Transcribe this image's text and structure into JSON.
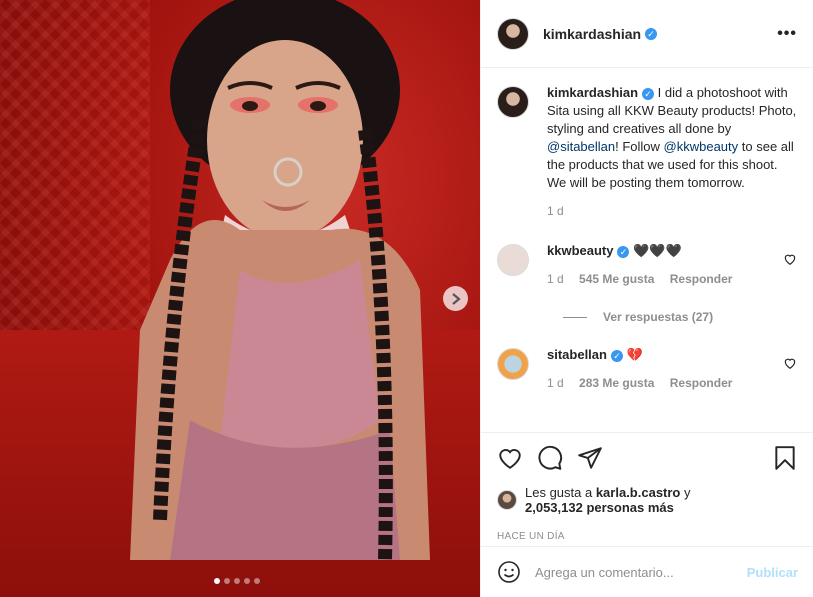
{
  "post": {
    "author": "kimkardashian",
    "more_icon": "more-horizontal-icon",
    "caption_text_1": "I did a photoshoot with Sita using all KKW Beauty products! Photo, styling and creatives all done by ",
    "caption_mention_1": "@sitabellan",
    "caption_text_2": "! Follow ",
    "caption_mention_2": "@kkwbeauty",
    "caption_text_3": " to see all the products that we used for this shoot. We will be posting them tomorrow.",
    "caption_time": "1 d",
    "carousel_total": 5,
    "carousel_active": 1
  },
  "comments": [
    {
      "user": "kkwbeauty",
      "text": "🖤🖤🖤",
      "time": "1 d",
      "likes": "545 Me gusta",
      "reply": "Responder",
      "view_replies": "Ver respuestas (27)"
    },
    {
      "user": "sitabellan",
      "text": "💔",
      "time": "1 d",
      "likes": "283 Me gusta",
      "reply": "Responder"
    }
  ],
  "likes": {
    "prefix": "Les gusta a ",
    "user": "karla.b.castro",
    "suffix": " y",
    "count": "2,053,132 personas más"
  },
  "timestamp": "HACE UN DÍA",
  "add_comment": {
    "placeholder": "Agrega un comentario...",
    "publish": "Publicar"
  },
  "colors": {
    "accent": "#3897f0",
    "publish_disabled": "#b2dffc",
    "muted": "#8e8e8e",
    "photo_red": "#b11a14"
  }
}
